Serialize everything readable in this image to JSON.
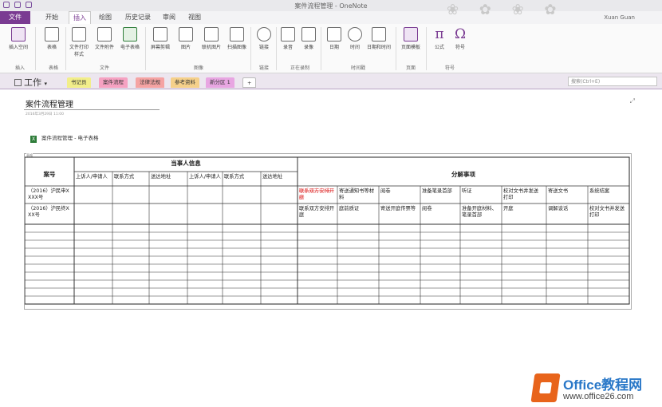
{
  "window": {
    "title": "案件流程管理 - OneNote",
    "user": "Xuan Guan"
  },
  "menu": {
    "tabs": [
      "文件",
      "开始",
      "插入",
      "绘图",
      "历史记录",
      "审阅",
      "视图"
    ],
    "active": "插入"
  },
  "ribbon": {
    "groups": [
      {
        "name": "插入",
        "buttons": [
          "插入空间"
        ]
      },
      {
        "name": "表格",
        "buttons": [
          "表格"
        ]
      },
      {
        "name": "文件",
        "buttons": [
          "文件打印样式",
          "文件附件",
          "电子表格"
        ]
      },
      {
        "name": "图像",
        "buttons": [
          "屏幕剪辑",
          "图片",
          "联机图片",
          "扫描图像"
        ]
      },
      {
        "name": "链接",
        "buttons": [
          "链接"
        ]
      },
      {
        "name": "正在录制",
        "buttons": [
          "录音",
          "录像"
        ]
      },
      {
        "name": "时间戳",
        "buttons": [
          "日期",
          "时间",
          "日期和时间"
        ]
      },
      {
        "name": "页面",
        "buttons": [
          "页面模板"
        ]
      },
      {
        "name": "符号",
        "buttons": [
          "公式",
          "符号"
        ]
      }
    ]
  },
  "notebook": {
    "name": "工作",
    "sections": [
      {
        "label": "书记员",
        "color": "#f2ee8a"
      },
      {
        "label": "案件流程",
        "color": "#f6a2c2"
      },
      {
        "label": "法律法规",
        "color": "#f5a3a3"
      },
      {
        "label": "参考资料",
        "color": "#f5d08a"
      },
      {
        "label": "新分区 1",
        "color": "#e8a6e2"
      },
      {
        "label": "+",
        "color": "#ffffff"
      }
    ],
    "search_placeholder": "搜索(Ctrl+E)"
  },
  "page": {
    "title": "案件流程管理",
    "date": "2016年3月29日    11:00",
    "attachment": "案件流程管理 - 电子表格"
  },
  "table": {
    "tag": "表格",
    "col_case": "案号",
    "party_header": "当事人信息",
    "decomp_header": "分解事项",
    "party_subheaders": [
      "上诉人/申请人",
      "联系方式",
      "送达地址",
      "上诉人/申请人",
      "联系方式",
      "送达地址"
    ],
    "rows": [
      {
        "case": "（2016）沪民申XXXX号",
        "items": [
          "联系双方安排开庭",
          "寄送通知书等材料",
          "阅卷",
          "准备笔录首部",
          "听证",
          "校对文书并发送打印",
          "寄送文书",
          "系统结案"
        ]
      },
      {
        "case": "（2016）沪民终XXX号",
        "items": [
          "联系双方安排开庭",
          "庭前质证",
          "寄送开庭传票等",
          "阅卷",
          "准备开庭材料、笔录首部",
          "开庭",
          "调解谈话",
          "校对文书并发送打印"
        ]
      }
    ],
    "empty_rows": 10
  },
  "watermark": {
    "brand": "Office教程网",
    "url": "www.office26.com"
  }
}
